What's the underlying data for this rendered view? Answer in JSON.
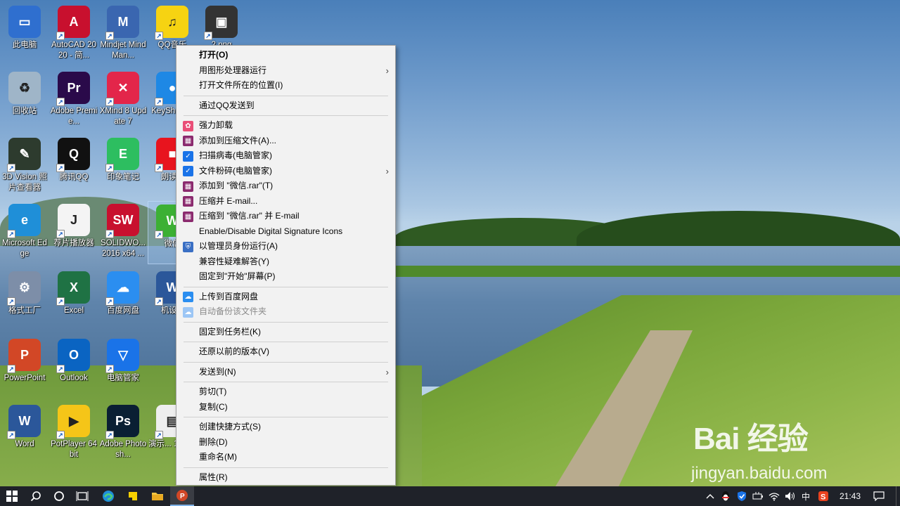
{
  "desktop": {
    "icons": [
      {
        "label": "此电脑",
        "glyph": "▭",
        "color": "#2f6fcf"
      },
      {
        "label": "AutoCAD 2020 - 简...",
        "glyph": "A",
        "color": "#c8102e"
      },
      {
        "label": "Mindjet MindMan...",
        "glyph": "M",
        "color": "#3a66b0"
      },
      {
        "label": "QQ音乐",
        "glyph": "♫",
        "color": "#f6d312"
      },
      {
        "label": "2.png",
        "glyph": "▣",
        "color": "#333333"
      },
      {
        "label": "回收站",
        "glyph": "♻",
        "color": "#9fb5c8"
      },
      {
        "label": "Adobe Premie...",
        "glyph": "Pr",
        "color": "#2a0a4a"
      },
      {
        "label": "XMind 8 Update 7",
        "glyph": "✕",
        "color": "#e3264a"
      },
      {
        "label": "KeySh... 64",
        "glyph": "●",
        "color": "#1e88e5"
      },
      {
        "label": "3D Vision 照片查看器",
        "glyph": "✎",
        "color": "#2d3b2e"
      },
      {
        "label": "腾讯QQ",
        "glyph": "Q",
        "color": "#111111"
      },
      {
        "label": "印象笔记",
        "glyph": "E",
        "color": "#2dbe60"
      },
      {
        "label": "朗读...",
        "glyph": "■",
        "color": "#e8141e"
      },
      {
        "label": "Microsoft Edge",
        "glyph": "e",
        "color": "#1f8fd8"
      },
      {
        "label": "荐片播放器",
        "glyph": "J",
        "color": "#f4f4f4"
      },
      {
        "label": "SOLIDWO... 2016 x64 ...",
        "glyph": "SW",
        "color": "#c8102e"
      },
      {
        "label": "微信",
        "glyph": "W",
        "color": "#3cb034"
      },
      {
        "label": "格式工厂",
        "glyph": "⚙",
        "color": "#7d8ea8"
      },
      {
        "label": "Excel",
        "glyph": "X",
        "color": "#1f7244"
      },
      {
        "label": "百度网盘",
        "glyph": "☁",
        "color": "#2b8ef0"
      },
      {
        "label": "机设...",
        "glyph": "W",
        "color": "#2b579a"
      },
      {
        "label": "PowerPoint",
        "glyph": "P",
        "color": "#d24726"
      },
      {
        "label": "Outlook",
        "glyph": "O",
        "color": "#0a64c2"
      },
      {
        "label": "电脑管家",
        "glyph": "▽",
        "color": "#1a73e8"
      },
      {
        "label": "Word",
        "glyph": "W",
        "color": "#2b579a"
      },
      {
        "label": "PotPlayer 64 bit",
        "glyph": "▶",
        "color": "#f5c518"
      },
      {
        "label": "Adobe Photosh...",
        "glyph": "Ps",
        "color": "#0a1f33"
      },
      {
        "label": "演示... 1.pp...",
        "glyph": "▤",
        "color": "#eeeeee"
      }
    ]
  },
  "context_menu": {
    "groups": [
      [
        {
          "label": "打开(O)",
          "bold": true
        },
        {
          "label": "用图形处理器运行",
          "submenu": true
        },
        {
          "label": "打开文件所在的位置(I)"
        }
      ],
      [
        {
          "label": "通过QQ发送到"
        }
      ],
      [
        {
          "label": "强力卸载",
          "icon": "uninstall-icon",
          "icon_glyph": "✿",
          "icon_color": "#e94e77"
        },
        {
          "label": "添加到压缩文件(A)...",
          "icon": "winrar-icon",
          "icon_glyph": "▦",
          "icon_color": "#8b2a6e"
        },
        {
          "label": "扫描病毒(电脑管家)",
          "icon": "shield-icon",
          "icon_glyph": "✓",
          "icon_color": "#1a73e8"
        },
        {
          "label": "文件粉碎(电脑管家)",
          "icon": "shield-icon",
          "icon_glyph": "✓",
          "icon_color": "#1a73e8",
          "submenu": true
        },
        {
          "label": "添加到 \"微信.rar\"(T)",
          "icon": "winrar-icon",
          "icon_glyph": "▦",
          "icon_color": "#8b2a6e"
        },
        {
          "label": "压缩并 E-mail...",
          "icon": "winrar-icon",
          "icon_glyph": "▦",
          "icon_color": "#8b2a6e"
        },
        {
          "label": "压缩到 \"微信.rar\" 并 E-mail",
          "icon": "winrar-icon",
          "icon_glyph": "▦",
          "icon_color": "#8b2a6e"
        },
        {
          "label": "Enable/Disable Digital Signature Icons"
        },
        {
          "label": "以管理员身份运行(A)",
          "icon": "uac-shield-icon",
          "icon_glyph": "⛨",
          "icon_color": "#3a6fc4"
        },
        {
          "label": "兼容性疑难解答(Y)"
        },
        {
          "label": "固定到\"开始\"屏幕(P)"
        }
      ],
      [
        {
          "label": "上传到百度网盘",
          "icon": "baidu-netdisk-icon",
          "icon_glyph": "☁",
          "icon_color": "#2b8ef0"
        },
        {
          "label": "自动备份该文件夹",
          "icon": "baidu-netdisk-icon",
          "icon_glyph": "☁",
          "icon_color": "#9cc6f5",
          "disabled": true
        }
      ],
      [
        {
          "label": "固定到任务栏(K)"
        }
      ],
      [
        {
          "label": "还原以前的版本(V)"
        }
      ],
      [
        {
          "label": "发送到(N)",
          "submenu": true
        }
      ],
      [
        {
          "label": "剪切(T)"
        },
        {
          "label": "复制(C)"
        }
      ],
      [
        {
          "label": "创建快捷方式(S)"
        },
        {
          "label": "删除(D)"
        },
        {
          "label": "重命名(M)"
        }
      ],
      [
        {
          "label": "属性(R)"
        }
      ]
    ]
  },
  "taskbar": {
    "ime": "中",
    "time": "21:43"
  },
  "watermark": {
    "brand": "Bai 经验",
    "url": "jingyan.baidu.com"
  }
}
